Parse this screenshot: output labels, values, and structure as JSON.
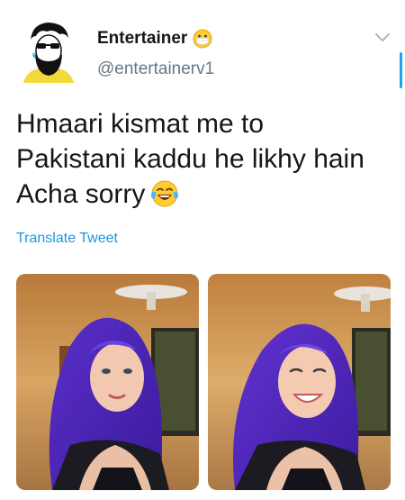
{
  "tweet": {
    "display_name": "Entertainer",
    "handle": "@entertainerv1",
    "text_lines": [
      "Hmaari kismat me to",
      "Pakistani kaddu he likhy hain",
      "Acha sorry"
    ],
    "translate_label": "Translate Tweet",
    "name_emoji": "face-with-medical-mask-icon",
    "text_emoji": "face-with-tears-of-joy-icon"
  },
  "colors": {
    "link": "#1b95e0",
    "handle": "#657786",
    "accent": "#1da1f2"
  },
  "media": [
    {
      "name": "photo-1"
    },
    {
      "name": "photo-2"
    }
  ]
}
